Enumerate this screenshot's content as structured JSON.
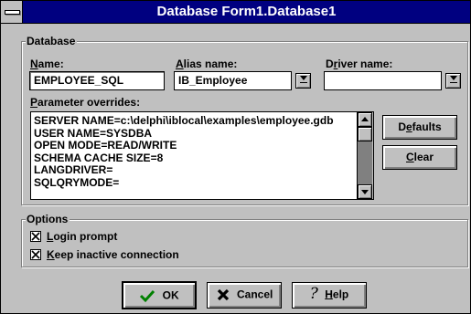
{
  "window": {
    "title": "Database Form1.Database1"
  },
  "database_group": {
    "legend": "Database",
    "name": {
      "label_ul": "N",
      "label_rest": "ame:",
      "value": "EMPLOYEE_SQL"
    },
    "alias": {
      "label_ul": "A",
      "label_rest": "lias name:",
      "value": "IB_Employee"
    },
    "driver": {
      "label_pre": "D",
      "label_ul": "r",
      "label_rest": "iver name:",
      "value": ""
    },
    "param": {
      "label_ul": "P",
      "label_rest": "arameter overrides:",
      "lines": [
        "SERVER NAME=c:\\delphi\\iblocal\\examples\\employee.gdb",
        "USER NAME=SYSDBA",
        "OPEN MODE=READ/WRITE",
        "SCHEMA CACHE SIZE=8",
        "LANGDRIVER=",
        "SQLQRYMODE="
      ]
    },
    "defaults_button": {
      "pre": "D",
      "ul": "e",
      "rest": "faults"
    },
    "clear_button": {
      "ul": "C",
      "rest": "lear"
    }
  },
  "options_group": {
    "legend": "Options",
    "login_prompt": {
      "ul": "L",
      "rest": "ogin prompt",
      "checked": true
    },
    "keep_inactive": {
      "ul": "K",
      "rest": "eep inactive connection",
      "checked": true
    }
  },
  "buttons": {
    "ok": {
      "icon": "checkmark-icon",
      "label": "OK"
    },
    "cancel": {
      "icon": "x-icon",
      "label": "Cancel"
    },
    "help": {
      "icon": "question-icon",
      "ul": "H",
      "rest": "elp"
    }
  },
  "colors": {
    "titlebar": "#000080",
    "face": "#c0c0c0",
    "ok_check": "#008000"
  }
}
